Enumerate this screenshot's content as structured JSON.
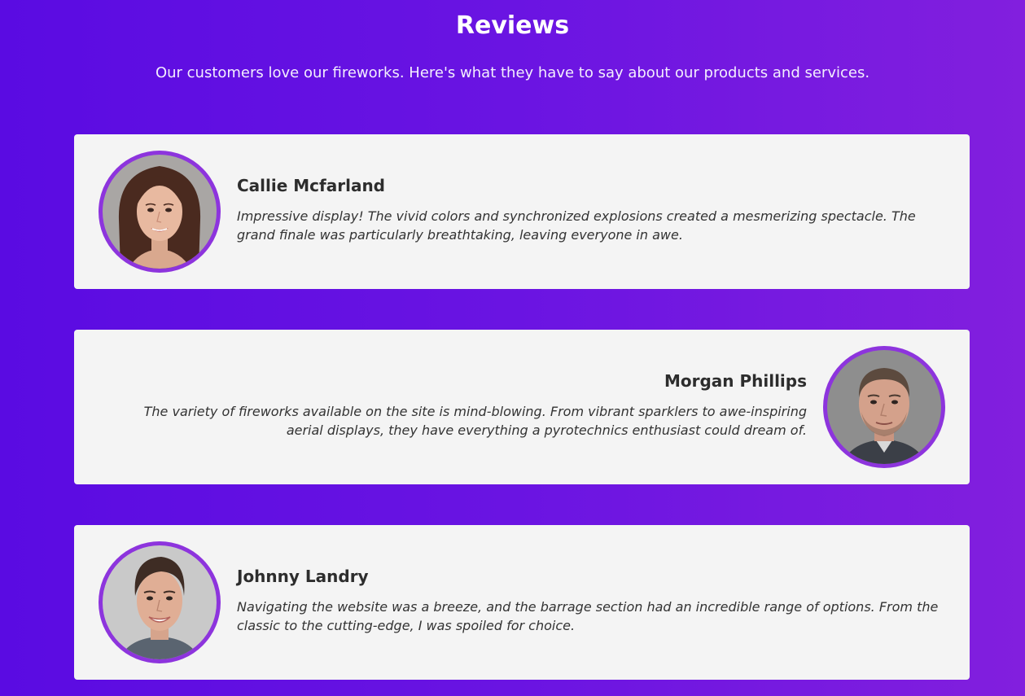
{
  "header": {
    "title": "Reviews",
    "subtitle": "Our customers love our fireworks. Here's what they have to say about our products and services."
  },
  "reviews": [
    {
      "name": "Callie Mcfarland",
      "text": "Impressive display! The vivid colors and synchronized explosions created a mesmerizing spectacle. The grand finale was particularly breathtaking, leaving everyone in awe.",
      "avatar_side": "left"
    },
    {
      "name": "Morgan Phillips",
      "text": "The variety of fireworks available on the site is mind-blowing. From vibrant sparklers to awe-inspiring aerial displays, they have everything a pyrotechnics enthusiast could dream of.",
      "avatar_side": "right"
    },
    {
      "name": "Johnny Landry",
      "text": "Navigating the website was a breeze, and the barrage section had an incredible range of options. From the classic to the cutting-edge, I was spoiled for choice.",
      "avatar_side": "left"
    }
  ],
  "colors": {
    "background_start": "#5a0be2",
    "background_end": "#821fde",
    "card": "#f4f4f4",
    "avatar_ring": "#8d34dd",
    "heading_text": "#ffffff"
  }
}
